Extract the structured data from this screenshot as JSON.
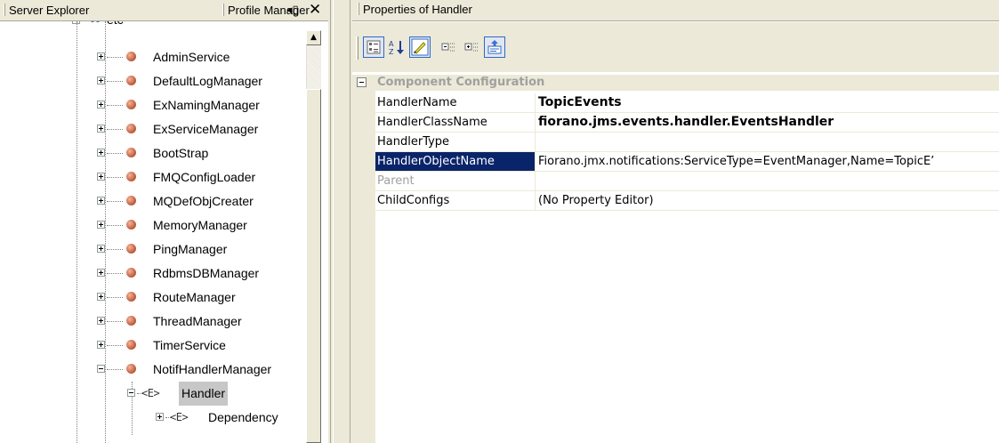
{
  "left_panel": {
    "tabs": [
      {
        "label": "Server Explorer"
      },
      {
        "label": "Profile Manager"
      }
    ],
    "tab_controls": "◂▯",
    "close_label": "✕",
    "tree": {
      "root_label": "etc",
      "services": [
        "AdminService",
        "DefaultLogManager",
        "ExNamingManager",
        "ExServiceManager",
        "BootStrap",
        "FMQConfigLoader",
        "MQDefObjCreater",
        "MemoryManager",
        "PingManager",
        "RdbmsDBManager",
        "RouteManager",
        "ThreadManager",
        "TimerService",
        "NotifHandlerManager"
      ],
      "handler_icon": "<E>",
      "handler_label": "Handler",
      "dependency_icon": "<E>",
      "dependency_label": "Dependency"
    }
  },
  "right_panel": {
    "title": "Properties of Handler",
    "toolbar": {
      "buttons": [
        {
          "icon": "categorized-icon",
          "pressed": true
        },
        {
          "icon": "sort-alpha-icon",
          "pressed": false
        },
        {
          "icon": "properties-icon",
          "pressed": true
        },
        {
          "icon": "collapse-icon",
          "pressed": false
        },
        {
          "icon": "expand-icon",
          "pressed": false
        },
        {
          "icon": "property-pages-icon",
          "pressed": true
        }
      ]
    },
    "category": "Component Configuration",
    "properties": [
      {
        "name": "HandlerName",
        "value": "TopicEvents",
        "bold": true
      },
      {
        "name": "HandlerClassName",
        "value": "fiorano.jms.events.handler.EventsHandler",
        "bold": true
      },
      {
        "name": "HandlerType",
        "value": ""
      },
      {
        "name": "HandlerObjectName",
        "value": "Fiorano.jmx.notifications:ServiceType=EventManager,Name=TopicE’",
        "selected": true
      },
      {
        "name": "Parent",
        "value": "",
        "dim": true
      },
      {
        "name": "ChildConfigs",
        "value": "(No Property Editor)"
      }
    ]
  },
  "colors": {
    "chrome": "#ece9d8",
    "selection": "#0a246a",
    "dim_text": "#a0a0a0"
  }
}
